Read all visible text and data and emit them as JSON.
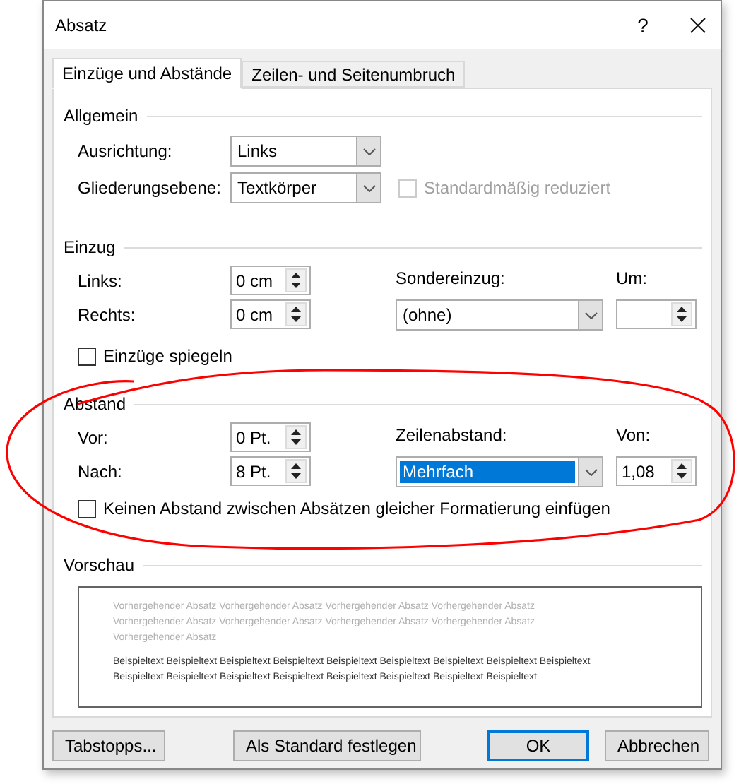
{
  "window": {
    "title": "Absatz",
    "help": "?"
  },
  "tabs": [
    {
      "label": "Einzüge und Abstände",
      "selected": true
    },
    {
      "label": "Zeilen- und Seitenumbruch",
      "selected": false
    }
  ],
  "general": {
    "title": "Allgemein",
    "fields": [
      {
        "label": "Ausrichtung:",
        "value": "Links"
      },
      {
        "label": "Gliederungsebene:",
        "value": "Textkörper"
      }
    ],
    "collapsed_checkbox": {
      "label": "Standardmäßig reduziert",
      "checked": false,
      "disabled": true
    }
  },
  "indent": {
    "title": "Einzug",
    "left": {
      "label": "Links:",
      "value": "0 cm"
    },
    "right": {
      "label": "Rechts:",
      "value": "0 cm"
    },
    "special": {
      "label": "Sondereinzug:",
      "value": "(ohne)",
      "selected": false
    },
    "by": {
      "label": "Um:"
    },
    "mirror": {
      "label": "Einzüge spiegeln",
      "checked": false
    }
  },
  "spacing": {
    "title": "Abstand",
    "before": {
      "label": "Vor:",
      "value": "0 Pt."
    },
    "after": {
      "label": "Nach:",
      "value": "8 Pt."
    },
    "line_spacing": {
      "label": "Zeilenabstand:",
      "value": "Mehrfach",
      "selected": true
    },
    "at": {
      "label": "Von:",
      "value": "1,08"
    },
    "no_space": {
      "label": "Keinen Abstand zwischen Absätzen gleicher Formatierung einfügen",
      "checked": false
    }
  },
  "preview": {
    "title": "Vorschau",
    "previous_text": "Vorhergehender Absatz Vorhergehender Absatz Vorhergehender Absatz Vorhergehender Absatz Vorhergehender Absatz Vorhergehender Absatz Vorhergehender Absatz Vorhergehender Absatz Vorhergehender Absatz",
    "sample_text": "Beispieltext Beispieltext Beispieltext Beispieltext Beispieltext Beispieltext Beispieltext Beispieltext Beispieltext Beispieltext Beispieltext Beispieltext Beispieltext Beispieltext Beispieltext Beispieltext Beispieltext"
  },
  "buttons": [
    {
      "label": "Tabstopps...",
      "default": false
    },
    {
      "label": "Als Standard festlegen",
      "default": false
    },
    {
      "label": "OK",
      "default": true
    },
    {
      "label": "Abbrechen",
      "default": false
    }
  ]
}
